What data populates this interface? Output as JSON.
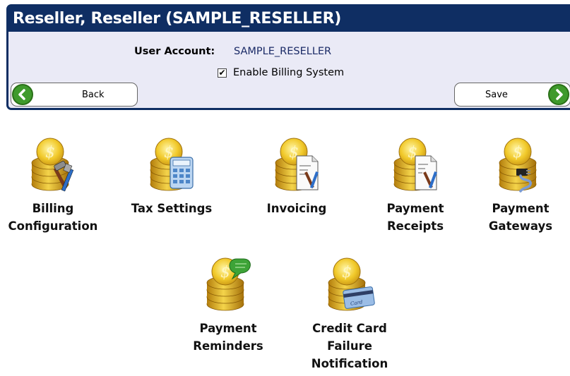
{
  "header": {
    "title": "Reseller, Reseller (SAMPLE_RESELLER)",
    "account_label": "User Account:",
    "account_value": "SAMPLE_RESELLER",
    "enable_billing_label": "Enable Billing System",
    "enable_billing_checked": true,
    "back_label": "Back",
    "save_label": "Save"
  },
  "colors": {
    "title_bar": "#0f2e63",
    "panel_bg": "#eaeaf6",
    "nav_button_green": "#3f9a2c"
  },
  "items": [
    {
      "line1": "Billing",
      "line2": "Configuration",
      "line3": "",
      "icon": "coins-tools-icon"
    },
    {
      "line1": "Tax Settings",
      "line2": "",
      "line3": "",
      "icon": "coins-calculator-icon"
    },
    {
      "line1": "Invoicing",
      "line2": "",
      "line3": "",
      "icon": "coins-document-tools-icon"
    },
    {
      "line1": "Payment",
      "line2": "Receipts",
      "line3": "",
      "icon": "coins-receipt-tools-icon"
    },
    {
      "line1": "Payment",
      "line2": "Gateways",
      "line3": "",
      "icon": "coins-plug-icon"
    },
    {
      "line1": "Payment",
      "line2": "Reminders",
      "line3": "",
      "icon": "coins-speech-bubble-icon"
    },
    {
      "line1": "Credit Card",
      "line2": "Failure",
      "line3": "Notification",
      "icon": "coins-credit-card-icon"
    }
  ]
}
